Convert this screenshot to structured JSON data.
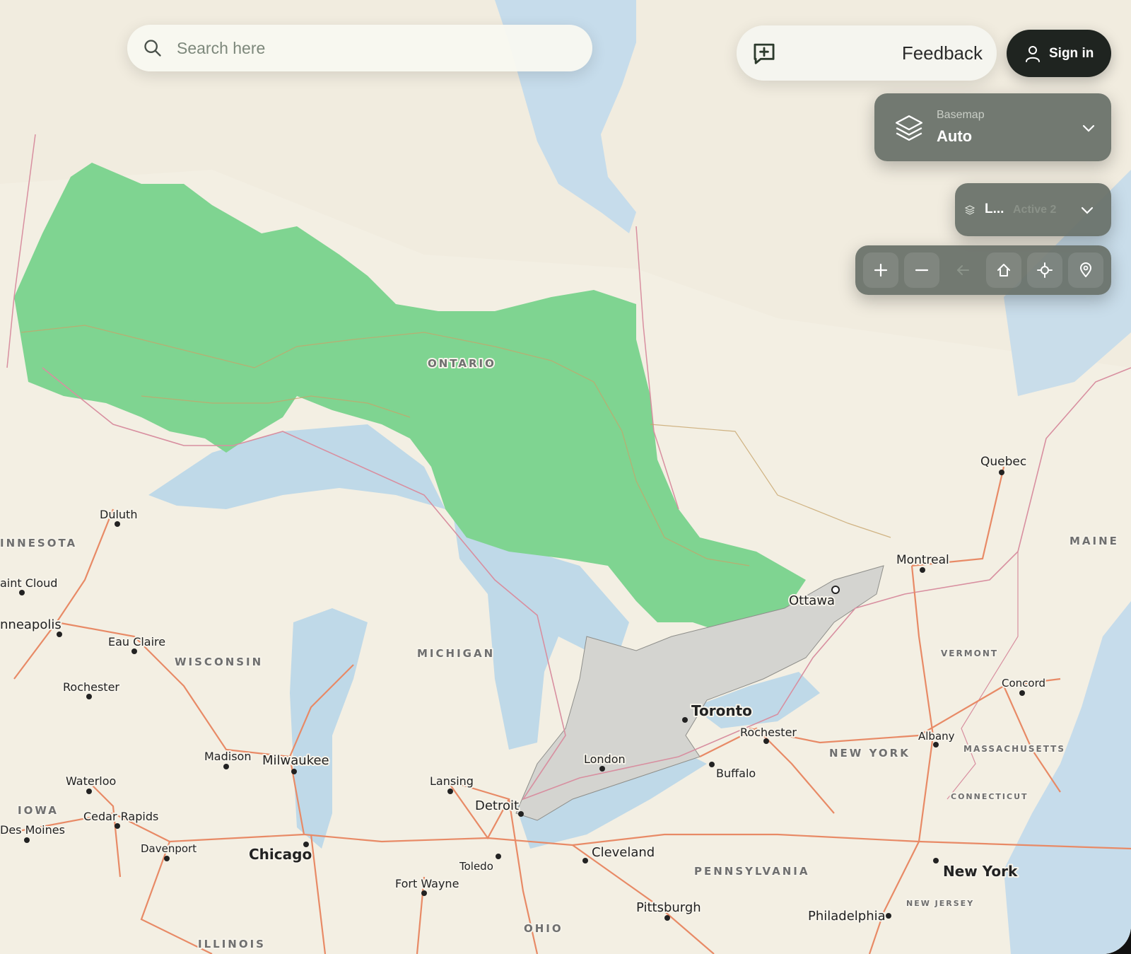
{
  "search": {
    "placeholder": "Search here",
    "icon": "search-icon"
  },
  "header": {
    "feedback_label": "Feedback",
    "feedback_icon": "message-plus-icon",
    "signin_label": "Sign in",
    "signin_icon": "user-icon"
  },
  "basemap": {
    "caption": "Basemap",
    "value": "Auto",
    "icon": "layers-icon"
  },
  "layers": {
    "label": "L...",
    "active": "Active 2"
  },
  "toolbar": {
    "buttons": [
      "zoom-in",
      "zoom-out",
      "back",
      "home",
      "locate",
      "place-marker"
    ]
  },
  "map": {
    "land_color": "#f3efe3",
    "water_color": "#bfd9e8",
    "highlight_color": "#7fd491",
    "road_color": "#e88a66",
    "region_labels": [
      "ONTARIO",
      "INNESOTA",
      "WISCONSIN",
      "MICHIGAN",
      "IOWA",
      "ILLINOIS",
      "OHIO",
      "PENNSYLVANIA",
      "NEW YORK",
      "VERMONT",
      "MASSACHUSETTS",
      "CONNECTICUT",
      "NEW JERSEY",
      "MAINE"
    ],
    "cities": [
      "Quebec",
      "Montreal",
      "Ottawa",
      "Toronto",
      "Rochester",
      "Buffalo",
      "London",
      "Albany",
      "Concord",
      "Duluth",
      "aint Cloud",
      "nneapolis",
      "Eau Claire",
      "Rochester",
      "Madison",
      "Milwaukee",
      "Waterloo",
      "Cedar Rapids",
      "Des Moines",
      "Davenport",
      "Chicago",
      "Lansing",
      "Detroit",
      "Toledo",
      "Fort Wayne",
      "Cleveland",
      "Pittsburgh",
      "Philadelphia",
      "New York"
    ]
  }
}
